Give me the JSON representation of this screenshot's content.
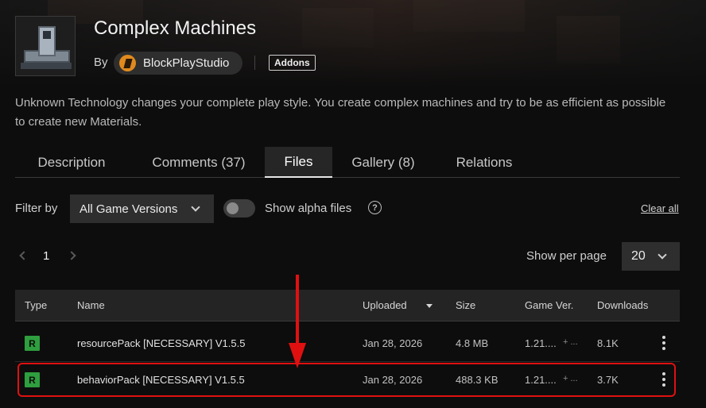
{
  "project": {
    "title": "Complex Machines",
    "by_label": "By",
    "author": "BlockPlayStudio",
    "category": "Addons",
    "summary": "Unknown Technology changes your complete play style. You create complex machines and try to be as efficient as possible to create new Materials."
  },
  "tabs": [
    {
      "label": "Description"
    },
    {
      "label": "Comments (37)"
    },
    {
      "label": "Files"
    },
    {
      "label": "Gallery (8)"
    },
    {
      "label": "Relations"
    }
  ],
  "active_tab": "Files",
  "filters": {
    "filter_by_label": "Filter by",
    "game_versions_selected": "All Game Versions",
    "show_alpha_label": "Show alpha files",
    "show_alpha_enabled": false,
    "help_glyph": "?",
    "clear_all_label": "Clear all"
  },
  "pagination": {
    "current_page": "1",
    "show_per_page_label": "Show per page",
    "per_page_value": "20"
  },
  "table": {
    "headers": {
      "type": "Type",
      "name": "Name",
      "uploaded": "Uploaded",
      "size": "Size",
      "game_ver": "Game Ver.",
      "downloads": "Downloads"
    },
    "rows": [
      {
        "type": "R",
        "name": "resourcePack [NECESSARY] V1.5.5",
        "uploaded": "Jan 28, 2026",
        "size": "4.8 MB",
        "game_ver": "1.21....",
        "game_ver_more": "+ ...",
        "downloads": "8.1K"
      },
      {
        "type": "R",
        "name": "behaviorPack [NECESSARY] V1.5.5",
        "uploaded": "Jan 28, 2026",
        "size": "488.3 KB",
        "game_ver": "1.21....",
        "game_ver_more": "+ ...",
        "downloads": "3.7K"
      }
    ]
  },
  "colors": {
    "release_badge": "#2e9e3e",
    "annotation": "#e01010",
    "author_avatar": "#e08a1e"
  },
  "icons": {
    "thumbnail": "project-thumbnail",
    "dropdown": "chevron-down-icon",
    "help": "question-circle-icon",
    "prev": "chevron-left-icon",
    "next": "chevron-right-icon",
    "sort": "caret-down-icon",
    "menu": "kebab-menu-icon"
  }
}
